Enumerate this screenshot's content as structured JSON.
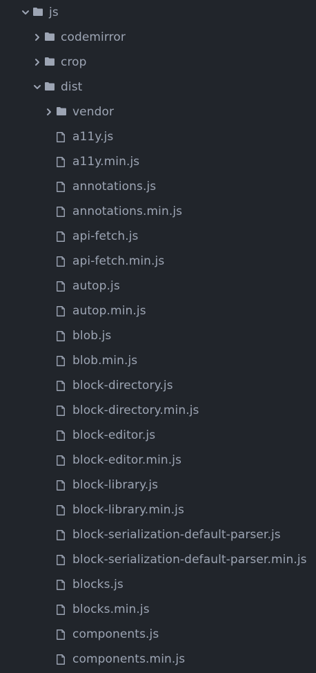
{
  "tree": {
    "items": [
      {
        "label": "js",
        "type": "folder",
        "state": "expanded",
        "depth": 0
      },
      {
        "label": "codemirror",
        "type": "folder",
        "state": "collapsed",
        "depth": 1
      },
      {
        "label": "crop",
        "type": "folder",
        "state": "collapsed",
        "depth": 1
      },
      {
        "label": "dist",
        "type": "folder",
        "state": "expanded",
        "depth": 1
      },
      {
        "label": "vendor",
        "type": "folder",
        "state": "collapsed",
        "depth": 2
      },
      {
        "label": "a11y.js",
        "type": "file",
        "depth": 2
      },
      {
        "label": "a11y.min.js",
        "type": "file",
        "depth": 2
      },
      {
        "label": "annotations.js",
        "type": "file",
        "depth": 2
      },
      {
        "label": "annotations.min.js",
        "type": "file",
        "depth": 2
      },
      {
        "label": "api-fetch.js",
        "type": "file",
        "depth": 2
      },
      {
        "label": "api-fetch.min.js",
        "type": "file",
        "depth": 2
      },
      {
        "label": "autop.js",
        "type": "file",
        "depth": 2
      },
      {
        "label": "autop.min.js",
        "type": "file",
        "depth": 2
      },
      {
        "label": "blob.js",
        "type": "file",
        "depth": 2
      },
      {
        "label": "blob.min.js",
        "type": "file",
        "depth": 2
      },
      {
        "label": "block-directory.js",
        "type": "file",
        "depth": 2
      },
      {
        "label": "block-directory.min.js",
        "type": "file",
        "depth": 2
      },
      {
        "label": "block-editor.js",
        "type": "file",
        "depth": 2
      },
      {
        "label": "block-editor.min.js",
        "type": "file",
        "depth": 2
      },
      {
        "label": "block-library.js",
        "type": "file",
        "depth": 2
      },
      {
        "label": "block-library.min.js",
        "type": "file",
        "depth": 2
      },
      {
        "label": "block-serialization-default-parser.js",
        "type": "file",
        "depth": 2
      },
      {
        "label": "block-serialization-default-parser.min.js",
        "type": "file",
        "depth": 2
      },
      {
        "label": "blocks.js",
        "type": "file",
        "depth": 2
      },
      {
        "label": "blocks.min.js",
        "type": "file",
        "depth": 2
      },
      {
        "label": "components.js",
        "type": "file",
        "depth": 2
      },
      {
        "label": "components.min.js",
        "type": "file",
        "depth": 2
      }
    ]
  },
  "colors": {
    "background": "#21252b",
    "text": "#9da5b4",
    "icon": "#9da5b4"
  },
  "icons": {
    "folder": "folder-icon",
    "file": "file-icon",
    "expanded": "chevron-down-icon",
    "collapsed": "chevron-right-icon"
  }
}
